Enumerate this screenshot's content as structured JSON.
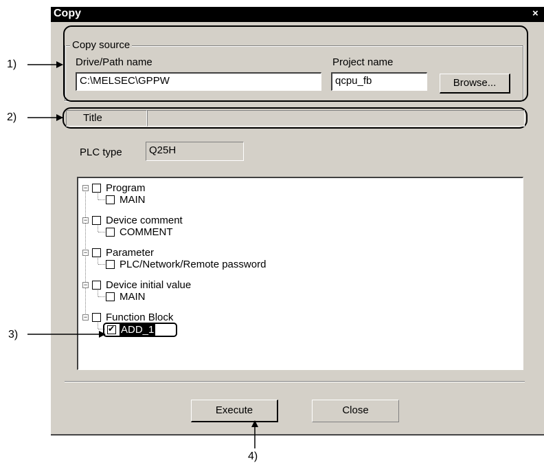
{
  "dialog": {
    "title": "Copy",
    "close_glyph": "×",
    "copy_source": {
      "group_label": "Copy source",
      "drive_label": "Drive/Path name",
      "drive_value": "C:\\MELSEC\\GPPW",
      "project_label": "Project name",
      "project_value": "qcpu_fb",
      "browse_label": "Browse..."
    },
    "title_label": "Title",
    "title_value": "",
    "plc_type_label": "PLC type",
    "plc_type_value": "Q25H",
    "tree": [
      {
        "label": "Program",
        "icon": "program-icon",
        "children": [
          {
            "label": "MAIN",
            "checked": false
          }
        ]
      },
      {
        "label": "Device comment",
        "icon": "device-comment-icon",
        "children": [
          {
            "label": "COMMENT",
            "checked": false
          }
        ]
      },
      {
        "label": "Parameter",
        "icon": "parameter-icon",
        "children": [
          {
            "label": "PLC/Network/Remote password",
            "checked": false
          }
        ]
      },
      {
        "label": "Device initial value",
        "icon": "device-initial-value-icon",
        "children": [
          {
            "label": "MAIN",
            "checked": false
          }
        ]
      },
      {
        "label": "Function Block",
        "icon": "function-block-icon",
        "children": [
          {
            "label": "ADD_1",
            "checked": true,
            "selected": true
          }
        ]
      }
    ],
    "execute_label": "Execute",
    "close_label": "Close"
  },
  "callouts": [
    "1)",
    "2)",
    "3)",
    "4)"
  ]
}
